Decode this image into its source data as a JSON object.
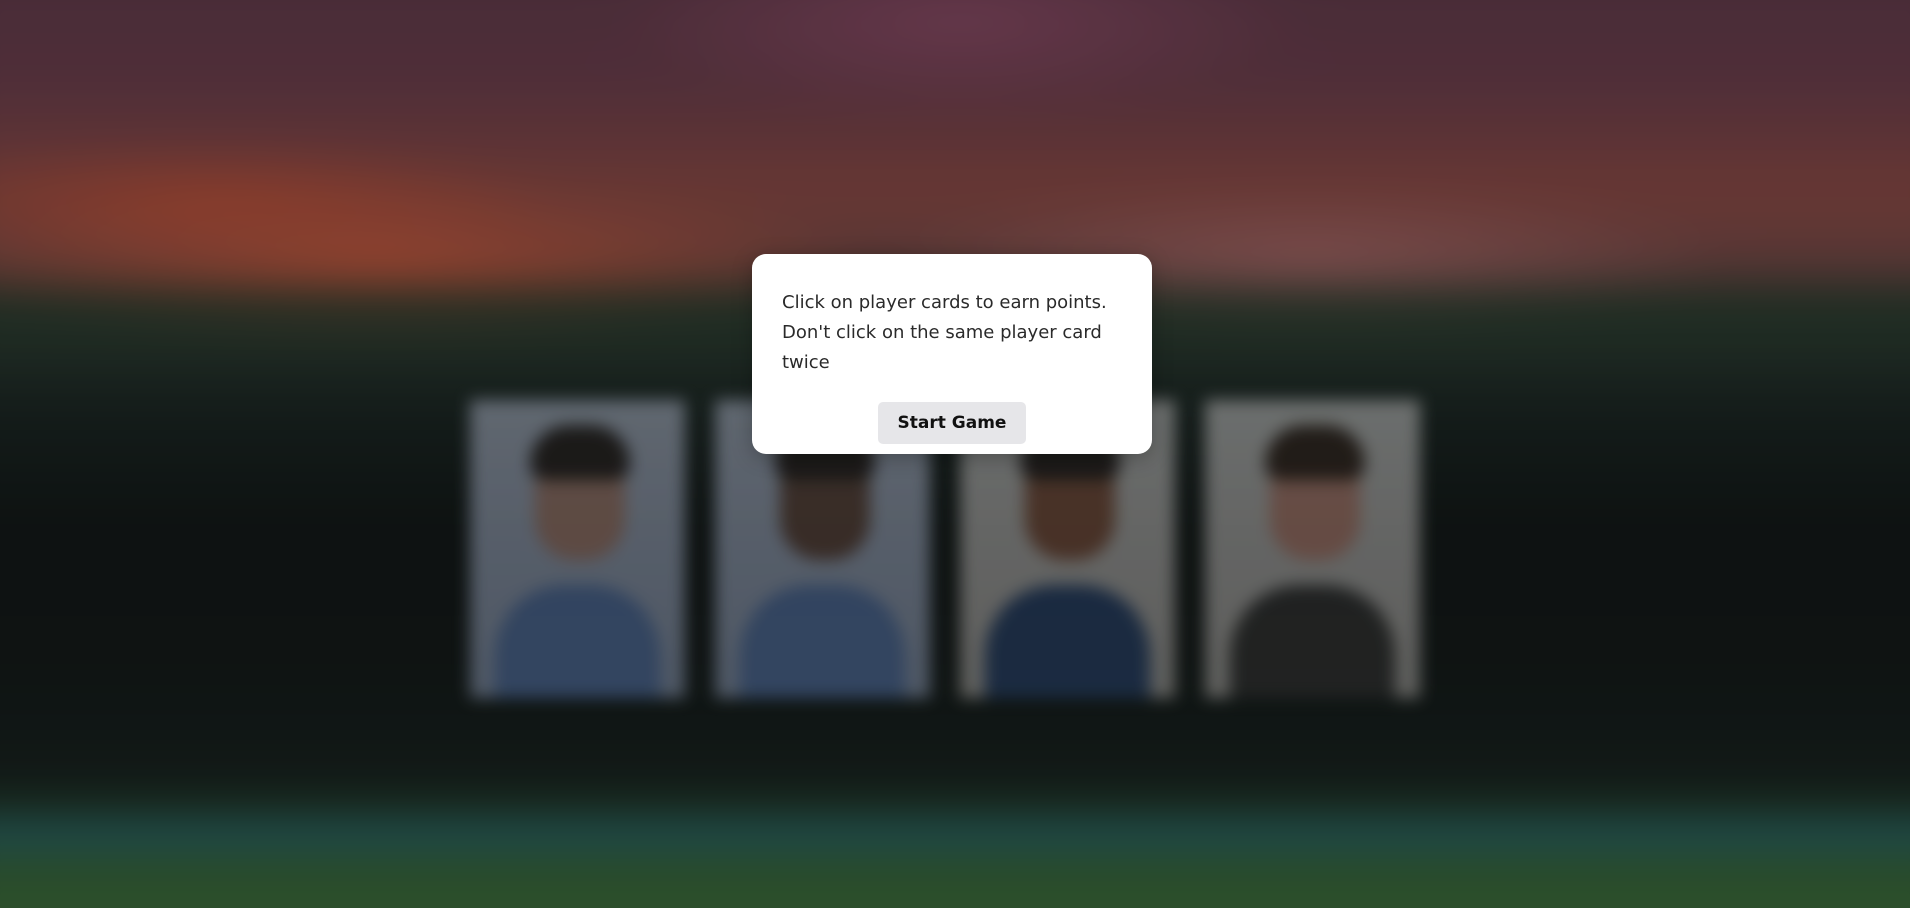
{
  "modal": {
    "message": "Click on player cards to earn points. Don't click on the same player card twice",
    "start_button_label": "Start Game"
  },
  "background": {
    "player_cards_count": 4
  }
}
